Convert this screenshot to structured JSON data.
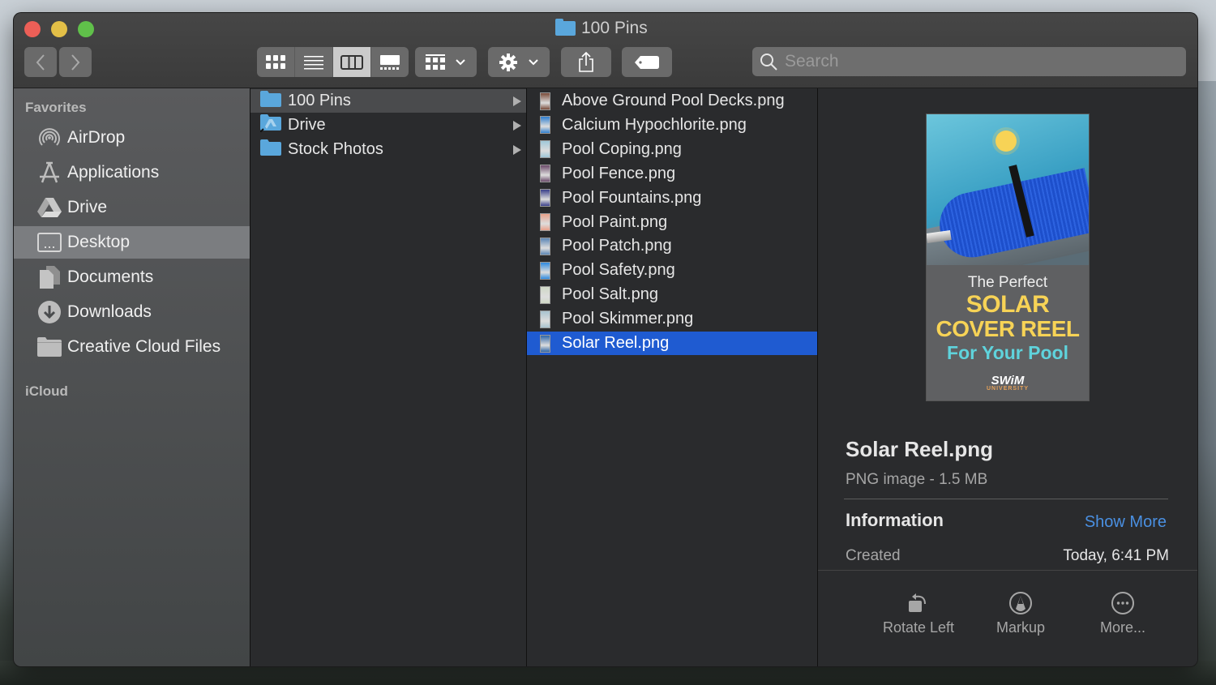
{
  "window": {
    "title": "100 Pins",
    "traffic_lights": {
      "close": "#ec5f57",
      "minimize": "#e3bf47",
      "maximize": "#60c04a"
    }
  },
  "toolbar": {
    "back_icon": "chevron-left-icon",
    "forward_icon": "chevron-right-icon",
    "view_modes": [
      {
        "name": "icon-view",
        "icon": "grid-icon",
        "active": false
      },
      {
        "name": "list-view",
        "icon": "list-icon",
        "active": false
      },
      {
        "name": "column-view",
        "icon": "columns-icon",
        "active": true
      },
      {
        "name": "gallery-view",
        "icon": "gallery-icon",
        "active": false
      }
    ],
    "group_icon": "group-grid-icon",
    "action_icon": "gear-icon",
    "share_icon": "share-icon",
    "tag_icon": "tag-icon",
    "search_placeholder": "Search"
  },
  "sidebar": {
    "sections": [
      {
        "title": "Favorites"
      },
      {
        "title": "iCloud"
      }
    ],
    "items": [
      {
        "label": "AirDrop",
        "icon": "airdrop-icon"
      },
      {
        "label": "Applications",
        "icon": "applications-icon"
      },
      {
        "label": "Drive",
        "icon": "google-drive-icon"
      },
      {
        "label": "Desktop",
        "icon": "desktop-icon",
        "active": true
      },
      {
        "label": "Documents",
        "icon": "documents-icon"
      },
      {
        "label": "Downloads",
        "icon": "downloads-icon"
      },
      {
        "label": "Creative Cloud Files",
        "icon": "folder-icon"
      }
    ]
  },
  "columns": {
    "folders": [
      {
        "label": "100 Pins",
        "selected": true
      },
      {
        "label": "Drive",
        "alias": true
      },
      {
        "label": "Stock Photos"
      }
    ],
    "files": [
      {
        "label": "Above Ground Pool Decks.png",
        "thumb": "#7a4b3a"
      },
      {
        "label": "Calcium Hypochlorite.png",
        "thumb": "#2f7fd0"
      },
      {
        "label": "Pool Coping.png",
        "thumb": "#9fc7d8"
      },
      {
        "label": "Pool Fence.png",
        "thumb": "#6b4a6a"
      },
      {
        "label": "Pool Fountains.png",
        "thumb": "#3a3f8a"
      },
      {
        "label": "Pool Paint.png",
        "thumb": "#e9a08a"
      },
      {
        "label": "Pool Patch.png",
        "thumb": "#5b86b6"
      },
      {
        "label": "Pool Safety.png",
        "thumb": "#2d8ae0"
      },
      {
        "label": "Pool Salt.png",
        "thumb": "#cfd8c6"
      },
      {
        "label": "Pool Skimmer.png",
        "thumb": "#a8c3cf"
      },
      {
        "label": "Solar Reel.png",
        "thumb": "#2f66a8",
        "selected": true
      }
    ]
  },
  "preview": {
    "image_text": {
      "line1": "The Perfect",
      "line2": "SOLAR",
      "line3": "COVER REEL",
      "line4": "For Your Pool",
      "logo": "SWiM",
      "logo_sub": "UNIVERSITY"
    },
    "filename": "Solar Reel.png",
    "kind": "PNG image - 1.5 MB",
    "info_heading": "Information",
    "show_more": "Show More",
    "created_label": "Created",
    "created_value": "Today, 6:41 PM",
    "actions": [
      {
        "label": "Rotate Left",
        "icon": "rotate-left-icon"
      },
      {
        "label": "Markup",
        "icon": "markup-icon"
      },
      {
        "label": "More...",
        "icon": "more-icon"
      }
    ]
  },
  "colors": {
    "selection": "#1f5bd1",
    "link": "#4a90e2",
    "folder": "#5aa7dc"
  }
}
